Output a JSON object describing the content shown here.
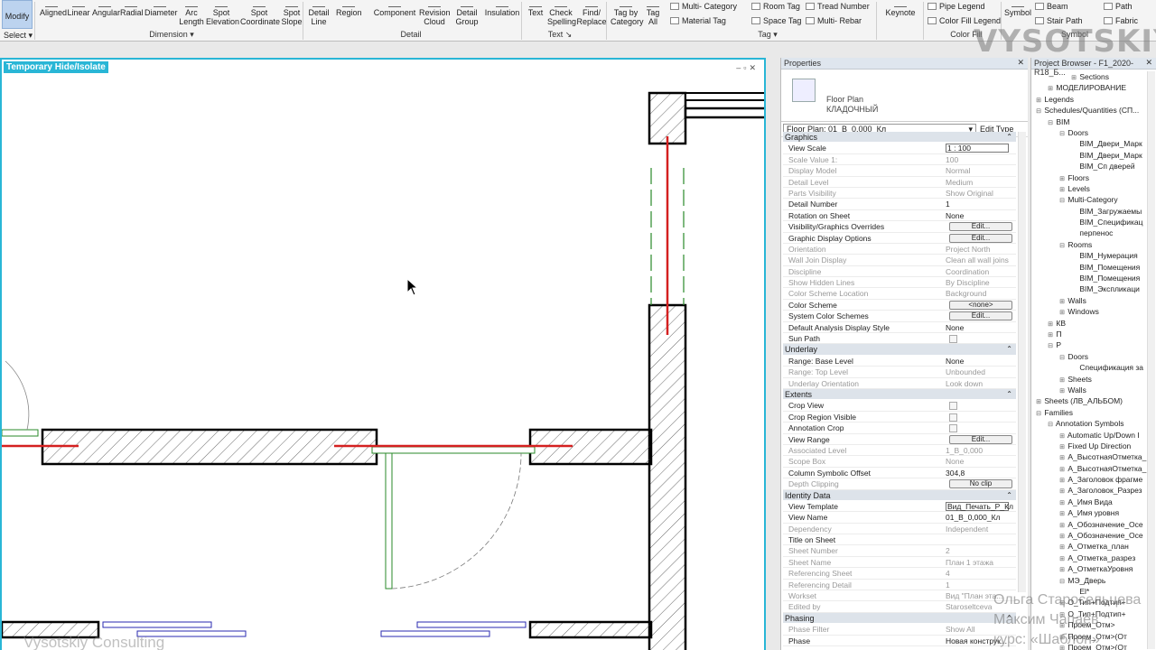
{
  "ribbon": {
    "modify": "Modify",
    "select": "Select",
    "tools": [
      {
        "name": "aligned",
        "label": "Aligned"
      },
      {
        "name": "linear",
        "label": "Linear"
      },
      {
        "name": "angular",
        "label": "Angular"
      },
      {
        "name": "radial",
        "label": "Radial"
      },
      {
        "name": "diameter",
        "label": "Diameter"
      },
      {
        "name": "arc-length",
        "label": "Arc\nLength"
      },
      {
        "name": "spot-elevation",
        "label": "Spot\nElevation"
      },
      {
        "name": "spot-coordinate",
        "label": "Spot\nCoordinate"
      },
      {
        "name": "spot-slope",
        "label": "Spot\nSlope"
      },
      {
        "name": "detail-line",
        "label": "Detail\nLine"
      },
      {
        "name": "region",
        "label": "Region"
      },
      {
        "name": "component",
        "label": "Component"
      },
      {
        "name": "revision-cloud",
        "label": "Revision\nCloud"
      },
      {
        "name": "detail-group",
        "label": "Detail\nGroup"
      },
      {
        "name": "insulation",
        "label": "Insulation"
      },
      {
        "name": "text",
        "label": "Text"
      },
      {
        "name": "check-spelling",
        "label": "Check\nSpelling"
      },
      {
        "name": "find-replace",
        "label": "Find/\nReplace"
      },
      {
        "name": "tag-by-category",
        "label": "Tag by\nCategory"
      },
      {
        "name": "tag-all",
        "label": "Tag\nAll"
      },
      {
        "name": "keynote",
        "label": "Keynote"
      },
      {
        "name": "symbol",
        "label": "Symbol"
      }
    ],
    "small_tools": {
      "multi_category": "Multi- Category",
      "material_tag": "Material Tag",
      "room_tag": "Room Tag",
      "space_tag": "Space Tag",
      "tread_number": "Tread Number",
      "multi_rebar": "Multi- Rebar",
      "pipe_legend": "Pipe Legend",
      "color_fill_legend": "Color Fill Legend",
      "beam": "Beam",
      "stair_path": "Stair Path",
      "path": "Path",
      "fabric": "Fabric"
    },
    "groups": {
      "dimension": "Dimension",
      "detail": "Detail",
      "text": "Text",
      "tag": "Tag",
      "color_fill": "Color Fill",
      "symbol": "Symbol"
    }
  },
  "watermark": {
    "brand": "VYSOTSKIY",
    "consulting": "Vysotskiy Consulting",
    "names": [
      "Ольга Старосельцева",
      "Максим Чапаев",
      "курс: «Шаблон»"
    ]
  },
  "view": {
    "banner": "Temporary Hide/Isolate"
  },
  "properties": {
    "title": "Properties",
    "family": "Floor Plan",
    "type": "КЛАДОЧНЫЙ",
    "instance_selector": "Floor Plan: 01_В_0,000_Кл",
    "edit_type": "Edit Type",
    "sections": [
      {
        "title": "Graphics",
        "rows": [
          {
            "k": "View Scale",
            "v": "1 : 100",
            "box": true
          },
          {
            "k": "Scale Value    1:",
            "v": "100",
            "ro": true
          },
          {
            "k": "Display Model",
            "v": "Normal",
            "ro": true
          },
          {
            "k": "Detail Level",
            "v": "Medium",
            "ro": true
          },
          {
            "k": "Parts Visibility",
            "v": "Show Original",
            "ro": true
          },
          {
            "k": "Detail Number",
            "v": "1"
          },
          {
            "k": "Rotation on Sheet",
            "v": "None"
          },
          {
            "k": "Visibility/Graphics Overrides",
            "v": "Edit...",
            "btn": true
          },
          {
            "k": "Graphic Display Options",
            "v": "Edit...",
            "btn": true
          },
          {
            "k": "Orientation",
            "v": "Project North",
            "ro": true
          },
          {
            "k": "Wall Join Display",
            "v": "Clean all wall joins",
            "ro": true
          },
          {
            "k": "Discipline",
            "v": "Coordination",
            "ro": true
          },
          {
            "k": "Show Hidden Lines",
            "v": "By Discipline",
            "ro": true
          },
          {
            "k": "Color Scheme Location",
            "v": "Background",
            "ro": true
          },
          {
            "k": "Color Scheme",
            "v": "<none>",
            "btn": true
          },
          {
            "k": "System Color Schemes",
            "v": "Edit...",
            "btn": true
          },
          {
            "k": "Default Analysis Display Style",
            "v": "None"
          },
          {
            "k": "Sun Path",
            "v": "",
            "chk": true
          }
        ]
      },
      {
        "title": "Underlay",
        "rows": [
          {
            "k": "Range: Base Level",
            "v": "None"
          },
          {
            "k": "Range: Top Level",
            "v": "Unbounded",
            "ro": true
          },
          {
            "k": "Underlay Orientation",
            "v": "Look down",
            "ro": true
          }
        ]
      },
      {
        "title": "Extents",
        "rows": [
          {
            "k": "Crop View",
            "v": "",
            "chk": true
          },
          {
            "k": "Crop Region Visible",
            "v": "",
            "chk": true
          },
          {
            "k": "Annotation Crop",
            "v": "",
            "chk": true
          },
          {
            "k": "View Range",
            "v": "Edit...",
            "btn": true
          },
          {
            "k": "Associated Level",
            "v": "1_В_0,000",
            "ro": true
          },
          {
            "k": "Scope Box",
            "v": "None",
            "ro": true
          },
          {
            "k": "Column Symbolic Offset",
            "v": "304,8"
          },
          {
            "k": "Depth Clipping",
            "v": "No clip",
            "btn": true,
            "ro": true
          }
        ]
      },
      {
        "title": "Identity Data",
        "rows": [
          {
            "k": "View Template",
            "v": "Вид_Печать_Р_Кл",
            "box": true
          },
          {
            "k": "View Name",
            "v": "01_В_0,000_Кл"
          },
          {
            "k": "Dependency",
            "v": "Independent",
            "ro": true
          },
          {
            "k": "Title on Sheet",
            "v": ""
          },
          {
            "k": "Sheet Number",
            "v": "2",
            "ro": true
          },
          {
            "k": "Sheet Name",
            "v": "План 1 этажа",
            "ro": true
          },
          {
            "k": "Referencing Sheet",
            "v": "4",
            "ro": true
          },
          {
            "k": "Referencing Detail",
            "v": "1",
            "ro": true
          },
          {
            "k": "Workset",
            "v": "Вид \"План эта...",
            "ro": true
          },
          {
            "k": "Edited by",
            "v": "Staroseltceva",
            "ro": true
          }
        ]
      },
      {
        "title": "Phasing",
        "rows": [
          {
            "k": "Phase Filter",
            "v": "Show All",
            "ro": true
          },
          {
            "k": "Phase",
            "v": "Новая конструк...",
            "ro": false
          }
        ]
      }
    ]
  },
  "browser": {
    "title": "Project Browser - F1_2020-R18_Б...",
    "items": [
      {
        "t": "Sections",
        "lvl": 3,
        "tg": "+"
      },
      {
        "t": "МОДЕЛИРОВАНИЕ",
        "lvl": 1,
        "tg": "+"
      },
      {
        "t": "Legends",
        "lvl": 0,
        "tg": "+"
      },
      {
        "t": "Schedules/Quantities (СП...",
        "lvl": 0,
        "tg": "−"
      },
      {
        "t": "BIM",
        "lvl": 1,
        "tg": "−"
      },
      {
        "t": "Doors",
        "lvl": 2,
        "tg": "−"
      },
      {
        "t": "BIM_Двери_Марк",
        "lvl": 3,
        "tg": ""
      },
      {
        "t": "BIM_Двери_Марк",
        "lvl": 3,
        "tg": ""
      },
      {
        "t": "BIM_Сп дверей",
        "lvl": 3,
        "tg": ""
      },
      {
        "t": "Floors",
        "lvl": 2,
        "tg": "+"
      },
      {
        "t": "Levels",
        "lvl": 2,
        "tg": "+"
      },
      {
        "t": "Multi-Category",
        "lvl": 2,
        "tg": "−"
      },
      {
        "t": "BIM_Загружаемы",
        "lvl": 3,
        "tg": ""
      },
      {
        "t": "BIM_Спецификац",
        "lvl": 3,
        "tg": ""
      },
      {
        "t": "перпенос",
        "lvl": 3,
        "tg": ""
      },
      {
        "t": "Rooms",
        "lvl": 2,
        "tg": "−"
      },
      {
        "t": "BIM_Нумерация",
        "lvl": 3,
        "tg": ""
      },
      {
        "t": "BIM_Помещения",
        "lvl": 3,
        "tg": ""
      },
      {
        "t": "BIM_Помещения",
        "lvl": 3,
        "tg": ""
      },
      {
        "t": "BIM_Экспликаци",
        "lvl": 3,
        "tg": ""
      },
      {
        "t": "Walls",
        "lvl": 2,
        "tg": "+"
      },
      {
        "t": "Windows",
        "lvl": 2,
        "tg": "+"
      },
      {
        "t": "КВ",
        "lvl": 1,
        "tg": "+"
      },
      {
        "t": "П",
        "lvl": 1,
        "tg": "+"
      },
      {
        "t": "Р",
        "lvl": 1,
        "tg": "−"
      },
      {
        "t": "Doors",
        "lvl": 2,
        "tg": "−"
      },
      {
        "t": "Спецификация за",
        "lvl": 3,
        "tg": ""
      },
      {
        "t": "Sheets",
        "lvl": 2,
        "tg": "+"
      },
      {
        "t": "Walls",
        "lvl": 2,
        "tg": "+"
      },
      {
        "t": "Sheets (ЛВ_АЛЬБОМ)",
        "lvl": 0,
        "tg": "+"
      },
      {
        "t": "Families",
        "lvl": 0,
        "tg": "−"
      },
      {
        "t": "Annotation Symbols",
        "lvl": 1,
        "tg": "−"
      },
      {
        "t": "Automatic Up/Down I",
        "lvl": 2,
        "tg": "+"
      },
      {
        "t": "Fixed Up Direction",
        "lvl": 2,
        "tg": "+"
      },
      {
        "t": "А_ВысотнаяОтметка_",
        "lvl": 2,
        "tg": "+"
      },
      {
        "t": "А_ВысотнаяОтметка_",
        "lvl": 2,
        "tg": "+"
      },
      {
        "t": "А_Заголовок фрагме",
        "lvl": 2,
        "tg": "+"
      },
      {
        "t": "А_Заголовок_Разрез",
        "lvl": 2,
        "tg": "+"
      },
      {
        "t": "А_Имя Вида",
        "lvl": 2,
        "tg": "+"
      },
      {
        "t": "А_Имя уровня",
        "lvl": 2,
        "tg": "+"
      },
      {
        "t": "А_Обозначение_Осе",
        "lvl": 2,
        "tg": "+"
      },
      {
        "t": "А_Обозначение_Осе",
        "lvl": 2,
        "tg": "+"
      },
      {
        "t": "А_Отметка_план",
        "lvl": 2,
        "tg": "+"
      },
      {
        "t": "А_Отметка_разрез",
        "lvl": 2,
        "tg": "+"
      },
      {
        "t": "А_ОтметкаУровня",
        "lvl": 2,
        "tg": "+"
      },
      {
        "t": "МЭ_Дверь",
        "lvl": 2,
        "tg": "−"
      },
      {
        "t": "El*",
        "lvl": 3,
        "tg": ""
      },
      {
        "t": "О_Тип+Подтип+",
        "lvl": 2,
        "tg": "+"
      },
      {
        "t": "О_Тип+Подтип+",
        "lvl": 2,
        "tg": "+"
      },
      {
        "t": "Проем_Отм>",
        "lvl": 2,
        "tg": "+"
      },
      {
        "t": "Проем_Отм>(От",
        "lvl": 2,
        "tg": "+"
      },
      {
        "t": "Проем_Отм>(От",
        "lvl": 2,
        "tg": "+"
      }
    ]
  }
}
